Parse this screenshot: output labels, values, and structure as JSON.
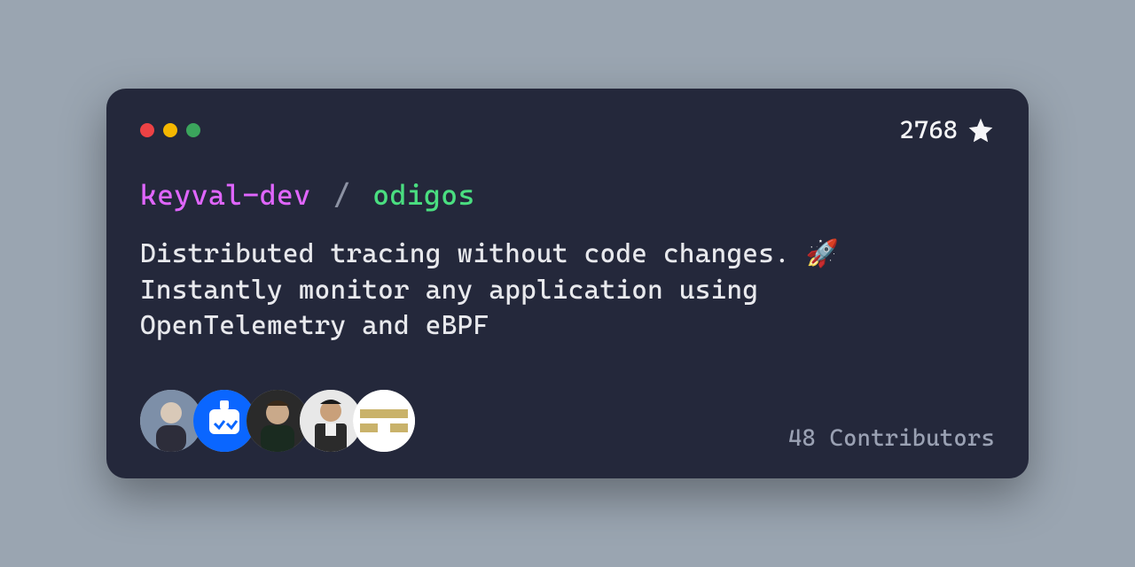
{
  "stars": "2768",
  "owner": "keyval-dev",
  "separator": "/",
  "repo": "odigos",
  "description": "Distributed tracing without code changes. 🚀 Instantly monitor any application using OpenTelemetry and eBPF",
  "contributors_label": "48 Contributors",
  "avatars_count": 5
}
